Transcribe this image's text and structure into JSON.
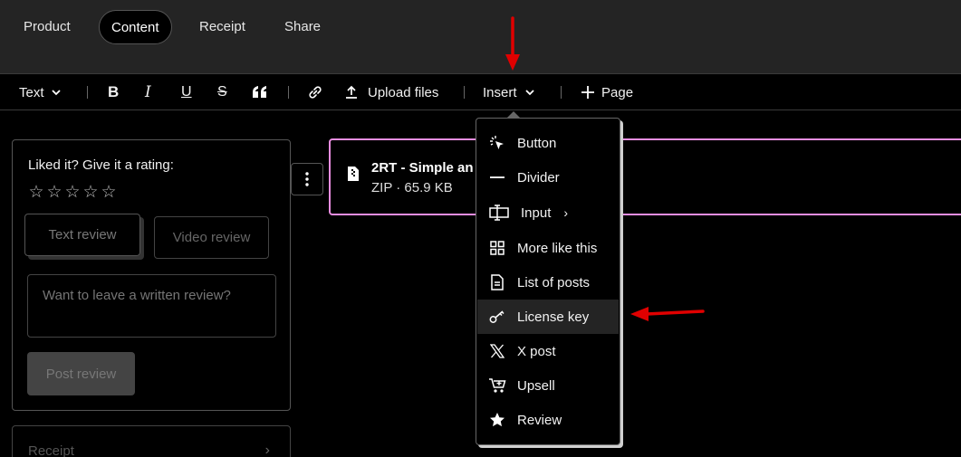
{
  "nav": {
    "tabs": [
      {
        "label": "Product"
      },
      {
        "label": "Content"
      },
      {
        "label": "Receipt"
      },
      {
        "label": "Share"
      }
    ],
    "active": "Content"
  },
  "toolbar": {
    "text_style": "Text",
    "upload_label": "Upload files",
    "insert_label": "Insert",
    "page_label": "Page"
  },
  "rating": {
    "title": "Liked it? Give it a rating:",
    "stars": [
      "☆",
      "☆",
      "☆",
      "☆",
      "☆"
    ],
    "text_review_label": "Text review",
    "video_review_label": "Video review",
    "review_placeholder": "Want to leave a written review?",
    "post_label": "Post review"
  },
  "receipt": {
    "label": "Receipt"
  },
  "file": {
    "name": "2RT - Simple an",
    "meta": "ZIP · 65.9 KB"
  },
  "insert_menu": {
    "items": [
      {
        "label": "Button",
        "icon": "cursor-click-icon"
      },
      {
        "label": "Divider",
        "icon": "divider-icon"
      },
      {
        "label": "Input",
        "icon": "input-icon",
        "submenu": true
      },
      {
        "label": "More like this",
        "icon": "grid-icon"
      },
      {
        "label": "List of posts",
        "icon": "document-icon"
      },
      {
        "label": "License key",
        "icon": "key-icon",
        "highlighted": true
      },
      {
        "label": "X post",
        "icon": "x-logo-icon"
      },
      {
        "label": "Upsell",
        "icon": "cart-icon"
      },
      {
        "label": "Review",
        "icon": "star-icon"
      }
    ]
  },
  "colors": {
    "accent_border": "#e98de0",
    "annotation_arrow": "#e00000",
    "nav_bg": "#242424"
  }
}
